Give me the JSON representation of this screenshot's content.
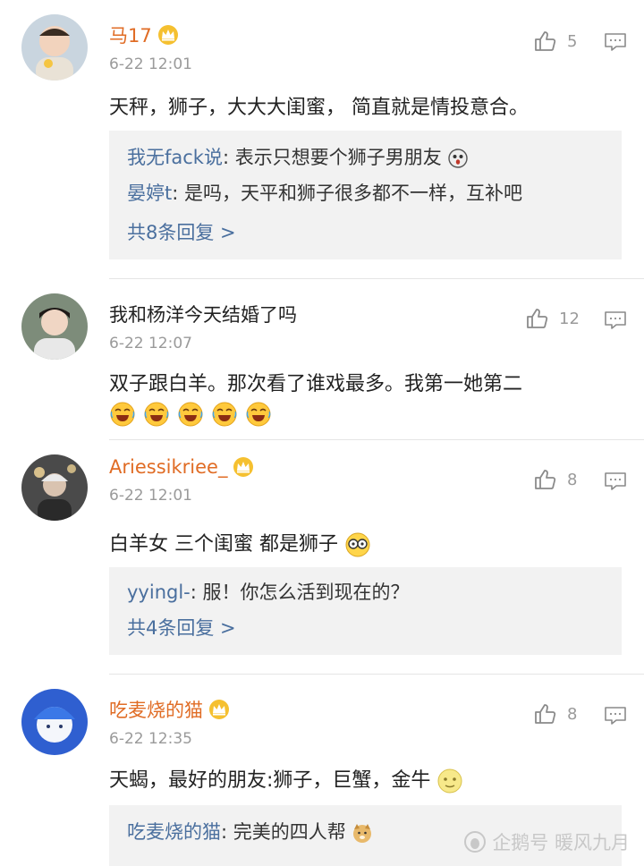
{
  "comments": [
    {
      "username": "马17",
      "has_badge": true,
      "time": "6-22 12:01",
      "likes": "5",
      "text": "天秤，狮子，大大大闺蜜， 简直就是情投意合。",
      "replies": [
        {
          "name": "我无fack说",
          "text": "表示只想要个狮子男朋友"
        },
        {
          "name": "晏婷t",
          "text": "是吗，天平和狮子很多都不一样，互补吧"
        }
      ],
      "more_replies": "共8条回复 >"
    },
    {
      "username": "我和杨洋今天结婚了吗",
      "has_badge": false,
      "time": "6-22 12:07",
      "likes": "12",
      "text": "双子跟白羊。那次看了谁戏最多。我第一她第二",
      "emoji_line": "crying-laughing-emoji x5"
    },
    {
      "username": "Ariessikriee_",
      "has_badge": true,
      "time": "6-22 12:01",
      "likes": "8",
      "text": "白羊女 三个闺蜜 都是狮子",
      "replies": [
        {
          "name": "yyingl-",
          "text": "服！你怎么活到现在的？"
        }
      ],
      "more_replies": "共4条回复 >"
    },
    {
      "username": "吃麦烧的猫",
      "has_badge": true,
      "time": "6-22 12:35",
      "likes": "8",
      "text": "天蝎，最好的朋友:狮子，巨蟹，金牛",
      "replies": [
        {
          "name": "吃麦烧的猫",
          "text": "完美的四人帮"
        }
      ]
    }
  ],
  "watermark": "企鹅号 暖风九月",
  "colors": {
    "username": "#e06c25",
    "link": "#4a6f9e",
    "meta": "#9a9a9a",
    "reply_bg": "#f2f2f2"
  }
}
